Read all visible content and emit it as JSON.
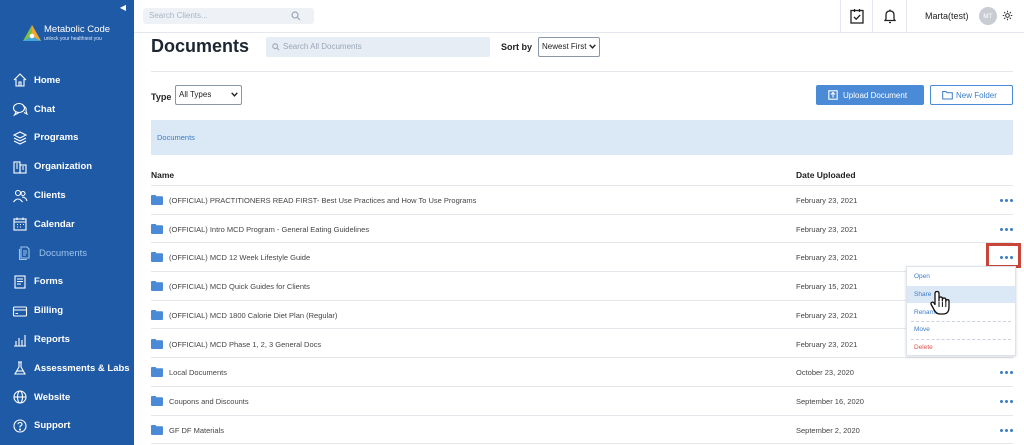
{
  "brand": {
    "name": "Metabolic Code",
    "tagline": "unlock your healthiest you"
  },
  "sidebar": {
    "items": [
      {
        "label": "Home",
        "icon": "home-icon"
      },
      {
        "label": "Chat",
        "icon": "chat-icon"
      },
      {
        "label": "Programs",
        "icon": "programs-icon"
      },
      {
        "label": "Organization",
        "icon": "organization-icon"
      },
      {
        "label": "Clients",
        "icon": "clients-icon"
      },
      {
        "label": "Calendar",
        "icon": "calendar-icon"
      },
      {
        "label": "Documents",
        "icon": "documents-icon",
        "active": true
      },
      {
        "label": "Forms",
        "icon": "forms-icon"
      },
      {
        "label": "Billing",
        "icon": "billing-icon"
      },
      {
        "label": "Reports",
        "icon": "reports-icon"
      },
      {
        "label": "Assessments & Labs",
        "icon": "assessments-icon"
      },
      {
        "label": "Website",
        "icon": "website-icon"
      },
      {
        "label": "Support",
        "icon": "support-icon"
      }
    ]
  },
  "topbar": {
    "search_placeholder": "Search Clients...",
    "user_name": "Marta(test)",
    "avatar_initials": "MT"
  },
  "header": {
    "title": "Documents",
    "search_placeholder": "Search All Documents",
    "sort_label": "Sort by",
    "sort_value": "Newest First",
    "type_label": "Type",
    "type_value": "All Types",
    "upload_button": "Upload Document",
    "new_folder_button": "New Folder"
  },
  "breadcrumb": "Documents",
  "table": {
    "columns": [
      "Name",
      "Date Uploaded"
    ],
    "rows": [
      {
        "name": "(OFFICIAL) PRACTITIONERS READ FIRST- Best Use Practices and How To Use Programs",
        "date": "February 23, 2021"
      },
      {
        "name": "(OFFICIAL) Intro MCD Program - General Eating Guidelines",
        "date": "February 23, 2021"
      },
      {
        "name": "(OFFICIAL) MCD 12 Week Lifestyle Guide",
        "date": "February 23, 2021"
      },
      {
        "name": "(OFFICIAL) MCD Quick Guides for Clients",
        "date": "February 15, 2021"
      },
      {
        "name": "(OFFICIAL) MCD 1800 Calorie Diet Plan (Regular)",
        "date": "February 23, 2021"
      },
      {
        "name": "(OFFICIAL) MCD Phase 1, 2, 3 General Docs",
        "date": "February 23, 2021"
      },
      {
        "name": "Local Documents",
        "date": "October 23, 2020"
      },
      {
        "name": "Coupons and Discounts",
        "date": "September 16, 2020"
      },
      {
        "name": "GF DF Materials",
        "date": "September 2, 2020"
      }
    ]
  },
  "context_menu": {
    "items": [
      "Open",
      "Share",
      "Rename",
      "Move",
      "Delete"
    ],
    "hovered": "Share"
  },
  "colors": {
    "sidebar": "#1f5aa6",
    "accent": "#4a8ad6",
    "danger": "#e0554d",
    "highlight": "#c9453a"
  }
}
